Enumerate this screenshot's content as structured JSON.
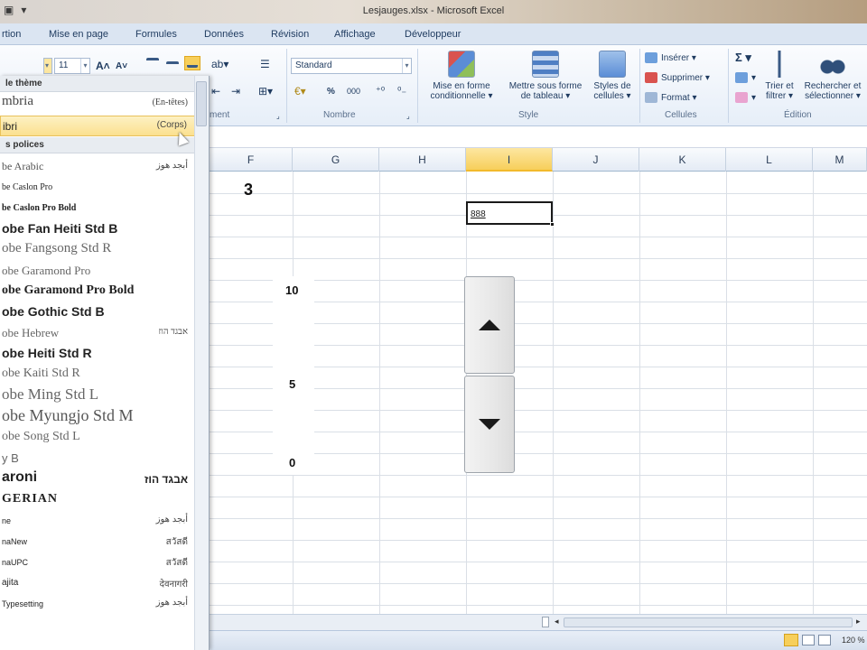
{
  "window": {
    "title": "Lesjauges.xlsx - Microsoft Excel"
  },
  "tabs": [
    {
      "label": "rtion"
    },
    {
      "label": "Mise en page"
    },
    {
      "label": "Formules"
    },
    {
      "label": "Données"
    },
    {
      "label": "Révision"
    },
    {
      "label": "Affichage"
    },
    {
      "label": "Développeur"
    }
  ],
  "ribbon": {
    "font_size": "11",
    "number_format": "Standard",
    "groups": {
      "alignment_label": "ment",
      "number_label": "Nombre",
      "style_label": "Style",
      "cells_label": "Cellules",
      "edition_label": "Édition"
    },
    "style_buttons": [
      {
        "label": "Mise en forme\nconditionnelle ▾"
      },
      {
        "label": "Mettre sous forme\nde tableau ▾"
      },
      {
        "label": "Styles de\ncellules ▾"
      }
    ],
    "cells_buttons": [
      {
        "label": "Insérer ▾"
      },
      {
        "label": "Supprimer ▾"
      },
      {
        "label": "Format ▾"
      }
    ],
    "edit_buttons": [
      {
        "label": "Trier et\nfiltrer ▾"
      },
      {
        "label": "Rechercher et\nsélectionner ▾"
      }
    ],
    "percent_symbol": "%",
    "thousands_symbol": "000",
    "sum_symbol": "Σ ▾"
  },
  "font_dropdown": {
    "theme_section": "le thème",
    "all_section": "s polices",
    "items": [
      {
        "name": "mbria",
        "sample": "(En-têtes)"
      },
      {
        "name": "ibri",
        "sample": "(Corps)"
      },
      {
        "name": "be Arabic",
        "sample": "أبجد هوز"
      },
      {
        "name": "be Caslon Pro",
        "sample": ""
      },
      {
        "name": "be Caslon Pro Bold",
        "sample": ""
      },
      {
        "name": "obe Fan Heiti Std B",
        "sample": ""
      },
      {
        "name": "obe Fangsong Std R",
        "sample": ""
      },
      {
        "name": "obe Garamond Pro",
        "sample": ""
      },
      {
        "name": "obe Garamond Pro Bold",
        "sample": ""
      },
      {
        "name": "obe Gothic Std B",
        "sample": ""
      },
      {
        "name": "obe Hebrew",
        "sample": "אבגד הוז"
      },
      {
        "name": "obe Heiti Std R",
        "sample": ""
      },
      {
        "name": "obe Kaiti Std R",
        "sample": ""
      },
      {
        "name": "obe Ming Std L",
        "sample": ""
      },
      {
        "name": "obe Myungjo Std M",
        "sample": ""
      },
      {
        "name": "obe Song Std L",
        "sample": ""
      },
      {
        "name": "y B",
        "sample": ""
      },
      {
        "name": "aroni",
        "sample": "אבגד הוז"
      },
      {
        "name": "GERIAN",
        "sample": ""
      },
      {
        "name": "ne",
        "sample": "أبجد هوز"
      },
      {
        "name": "naNew",
        "sample": "สวัสดี"
      },
      {
        "name": "naUPC",
        "sample": "สวัสดี"
      },
      {
        "name": "ajita",
        "sample": "देवनागरी"
      },
      {
        "name": "Typesetting",
        "sample": "أبجد هوز"
      }
    ]
  },
  "grid": {
    "columns": [
      "F",
      "G",
      "H",
      "I",
      "J",
      "K",
      "L",
      "M"
    ],
    "selected_column": "I",
    "cell_F": "3",
    "active_cell_value": "888",
    "gauge_labels": {
      "top": "10",
      "mid": "5",
      "bottom": "0"
    }
  },
  "status": {
    "zoom": "120 %"
  }
}
